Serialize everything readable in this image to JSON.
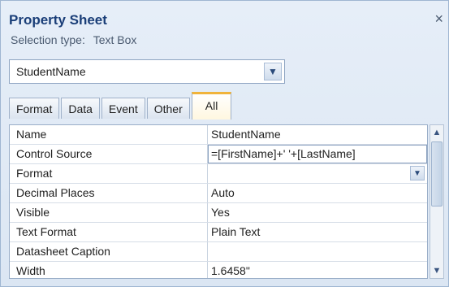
{
  "panel": {
    "title": "Property Sheet",
    "close_glyph": "×",
    "selection_type_label": "Selection type:",
    "selection_type_value": "Text Box"
  },
  "selector": {
    "value": "StudentName",
    "dropdown_icon": "chevron-down-icon"
  },
  "tabs": [
    {
      "label": "Format",
      "active": false
    },
    {
      "label": "Data",
      "active": false
    },
    {
      "label": "Event",
      "active": false
    },
    {
      "label": "Other",
      "active": false
    },
    {
      "label": "All",
      "active": true
    }
  ],
  "properties": [
    {
      "name": "Name",
      "value": "StudentName"
    },
    {
      "name": "Control Source",
      "value": "=[FirstName]+' '+[LastName]"
    },
    {
      "name": "Format",
      "value": ""
    },
    {
      "name": "Decimal Places",
      "value": "Auto"
    },
    {
      "name": "Visible",
      "value": "Yes"
    },
    {
      "name": "Text Format",
      "value": "Plain Text"
    },
    {
      "name": "Datasheet Caption",
      "value": ""
    },
    {
      "name": "Width",
      "value": "1.6458\""
    }
  ],
  "colors": {
    "title": "#1a3e78",
    "active_tab_accent": "#f0b33a",
    "panel_bg": "#dfe9f5"
  }
}
